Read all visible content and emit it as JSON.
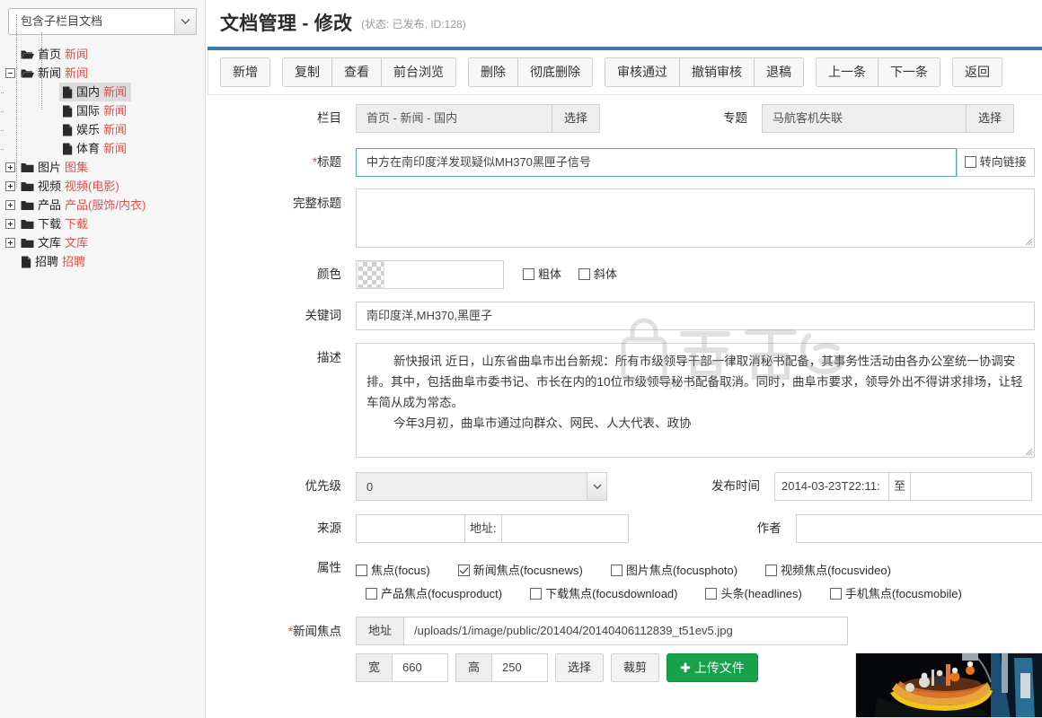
{
  "sidebar": {
    "filter_select": {
      "value": "包含子栏目文档",
      "icon": "chevron-down-icon"
    },
    "tree": [
      {
        "level": 1,
        "toggle": "none",
        "icon": "folder-open-icon",
        "label": "首页",
        "category": "新闻",
        "selected": false
      },
      {
        "level": 1,
        "toggle": "minus",
        "icon": "folder-open-icon",
        "label": "新闻",
        "category": "新闻",
        "selected": false
      },
      {
        "level": 3,
        "toggle": "none",
        "icon": "file-icon",
        "label": "国内",
        "category": "新闻",
        "selected": true
      },
      {
        "level": 3,
        "toggle": "none",
        "icon": "file-icon",
        "label": "国际",
        "category": "新闻",
        "selected": false
      },
      {
        "level": 3,
        "toggle": "none",
        "icon": "file-icon",
        "label": "娱乐",
        "category": "新闻",
        "selected": false
      },
      {
        "level": 3,
        "toggle": "none",
        "icon": "file-icon",
        "label": "体育",
        "category": "新闻",
        "selected": false
      },
      {
        "level": 1,
        "toggle": "plus",
        "icon": "folder-icon",
        "label": "图片",
        "category": "图集",
        "selected": false
      },
      {
        "level": 1,
        "toggle": "plus",
        "icon": "folder-icon",
        "label": "视频",
        "category": "视频(电影)",
        "selected": false
      },
      {
        "level": 1,
        "toggle": "plus",
        "icon": "folder-icon",
        "label": "产品",
        "category": "产品(服饰/内衣)",
        "selected": false
      },
      {
        "level": 1,
        "toggle": "plus",
        "icon": "folder-icon",
        "label": "下载",
        "category": "下载",
        "selected": false
      },
      {
        "level": 1,
        "toggle": "plus",
        "icon": "folder-icon",
        "label": "文库",
        "category": "文库",
        "selected": false
      },
      {
        "level": 1,
        "toggle": "none",
        "icon": "file-icon",
        "label": "招聘",
        "category": "招聘",
        "selected": false
      }
    ]
  },
  "header": {
    "title": "文档管理 - 修改",
    "status": "(状态: 已发布, ID:128)",
    "accent_color": "#3b7ba6"
  },
  "toolbar": {
    "groups": [
      {
        "buttons": [
          "新增"
        ]
      },
      {
        "buttons": [
          "复制",
          "查看",
          "前台浏览"
        ]
      },
      {
        "buttons": [
          "删除",
          "彻底删除"
        ]
      },
      {
        "buttons": [
          "审核通过",
          "撤销审核",
          "退稿"
        ]
      },
      {
        "buttons": [
          "上一条",
          "下一条"
        ]
      },
      {
        "buttons": [
          "返回"
        ]
      }
    ]
  },
  "form": {
    "column": {
      "label": "栏目",
      "value": "首页 - 新闻 - 国内",
      "button": "选择"
    },
    "special": {
      "label": "专题",
      "value": "马航客机失联",
      "button": "选择"
    },
    "title": {
      "label": "标题",
      "required": true,
      "value": "中方在南印度洋发现疑似MH370黑匣子信号",
      "redirect_checkbox": {
        "label": "转向链接",
        "checked": false
      }
    },
    "full_title": {
      "label": "完整标题",
      "value": ""
    },
    "color": {
      "label": "颜色",
      "value": "",
      "swatch": "transparent-checker",
      "bold": {
        "label": "粗体",
        "checked": false
      },
      "italic": {
        "label": "斜体",
        "checked": false
      }
    },
    "keywords": {
      "label": "关键词",
      "value": "南印度洋,MH370,黑匣子"
    },
    "description": {
      "label": "描述",
      "value": "        新快报讯 近日，山东省曲阜市出台新规：所有市级领导干部一律取消秘书配备，其事务性活动由各办公室统一协调安排。其中，包括曲阜市委书记、市长在内的10位市级领导秘书配备取消。同时，曲阜市要求，领导外出不得讲求排场，让轻车简从成为常态。\n        今年3月初，曲阜市通过向群众、网民、人大代表、政协"
    },
    "priority": {
      "label": "优先级",
      "value": "0",
      "icon": "chevron-down-icon"
    },
    "publish_time": {
      "label": "发布时间",
      "value": "2014-03-23T22:11:",
      "separator": "至",
      "end_value": ""
    },
    "source": {
      "label": "来源",
      "value": "",
      "addon": "地址:",
      "url_value": ""
    },
    "author": {
      "label": "作者",
      "value": ""
    },
    "attributes": {
      "label": "属性",
      "items": [
        {
          "label": "焦点(focus)",
          "checked": false
        },
        {
          "label": "新闻焦点(focusnews)",
          "checked": true
        },
        {
          "label": "图片焦点(focusphoto)",
          "checked": false
        },
        {
          "label": "视频焦点(focusvideo)",
          "checked": false
        },
        {
          "label": "产品焦点(focusproduct)",
          "checked": false
        },
        {
          "label": "下载焦点(focusdownload)",
          "checked": false
        },
        {
          "label": "头条(headlines)",
          "checked": false
        },
        {
          "label": "手机焦点(focusmobile)",
          "checked": false
        }
      ]
    },
    "news_focus": {
      "label": "新闻焦点",
      "required": true,
      "address_addon": "地址",
      "address_value": "/uploads/1/image/public/201404/20140406112839_t51ev5.jpg",
      "width_addon": "宽",
      "width_value": "660",
      "height_addon": "高",
      "height_value": "250",
      "select_button": "选择",
      "crop_button": "裁剪",
      "upload_button": "上传文件",
      "upload_color": "#17a24a"
    }
  },
  "watermark": {
    "text": "安下载",
    "sub": "anxz.com"
  }
}
